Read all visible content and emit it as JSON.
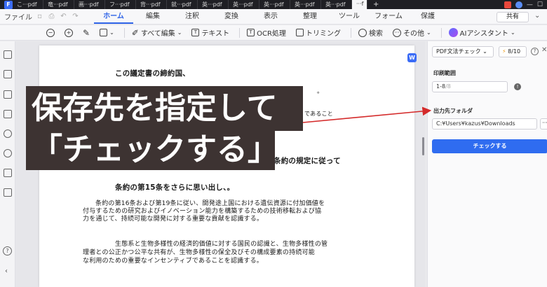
{
  "window": {
    "app_logo": "F",
    "tabs": [
      "こ···pdf",
      "竜···pdf",
      "画···pdf",
      "フ···pdf",
      "背···pdf",
      "就···pdf",
      "英···pdf",
      "英···pdf",
      "英···pdf",
      "英···pdf",
      "英···pdf",
      "···f"
    ],
    "new_tab": "+",
    "controls": [
      "—",
      "☐"
    ]
  },
  "menubar": {
    "file": "ファイル",
    "tabs": [
      "ホーム",
      "編集",
      "注釈",
      "変換",
      "表示",
      "整理",
      "ツール",
      "フォーム",
      "保護"
    ],
    "active_tab": "ホーム",
    "share": "共有",
    "more": "⌄"
  },
  "toolbar": {
    "edit_all": "すべて編集",
    "text": "テキスト",
    "ocr": "OCR処理",
    "trimming": "トリミング",
    "search": "検索",
    "others": "その他",
    "ai_assistant": "AIアシスタント"
  },
  "document": {
    "lines": [
      "この議定書の締約国、",
      "。",
      "であること",
      "条約の規定に従って",
      "条約の第15条をさらに思い出し、。",
      "条約の第16条および第19条に従い、開発途上国における遺伝資源に付加価値を",
      "付与するための研究およびイノベーション能力を構築するための技術移転および協",
      "力を通じて、持続可能な開発に対する重要な貢献を認識する。",
      "生態系と生物多様性の経済的価値に対する国民の認識と、生物多様性の管",
      "理者との公正かつ公平な共有が、生物多様性の保全及びその構成要素の持続可能",
      "な利用のための重要なインセンティブであることを認識する。"
    ]
  },
  "caption": {
    "line1": "保存先を指定して",
    "line2": "「チェックする」"
  },
  "panel": {
    "tool_select": "PDF文法チェック ⌄",
    "count": "8/10",
    "help": "?",
    "close": "✕",
    "range_label": "印刷範囲",
    "range_value": "1-8",
    "range_total": "/8",
    "output_label": "出力先フォルダ",
    "output_path": "C:¥Users¥kazus¥Downloads",
    "browse": "···",
    "check_button": "チェックする",
    "side_badge": "W"
  },
  "colors": {
    "accent": "#2f64e8",
    "caption_bg": "#3d3332",
    "arrow": "#d42a2a"
  }
}
